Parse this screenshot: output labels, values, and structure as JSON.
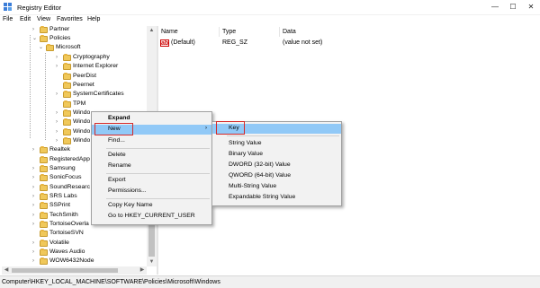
{
  "window": {
    "title": "Registry Editor",
    "minimize_icon": "—",
    "maximize_icon": "☐",
    "close_icon": "✕"
  },
  "menu": [
    "File",
    "Edit",
    "View",
    "Favorites",
    "Help"
  ],
  "tree": [
    {
      "label": "Partner",
      "expander": "›"
    },
    {
      "label": "Policies",
      "expander": "⌄"
    },
    {
      "label": "Microsoft",
      "expander": "⌄"
    },
    {
      "label": "Cryptography",
      "expander": "›"
    },
    {
      "label": "Internet Explorer",
      "expander": "›"
    },
    {
      "label": "PeerDist",
      "expander": ""
    },
    {
      "label": "Peernet",
      "expander": ""
    },
    {
      "label": "SystemCertificates",
      "expander": "›"
    },
    {
      "label": "TPM",
      "expander": ""
    },
    {
      "label": "Windo",
      "expander": "›"
    },
    {
      "label": "Windo",
      "expander": "›"
    },
    {
      "label": "Windo",
      "expander": "›"
    },
    {
      "label": "Windo",
      "expander": "›"
    },
    {
      "label": "Realtek",
      "expander": "›"
    },
    {
      "label": "RegisteredApp",
      "expander": ""
    },
    {
      "label": "Samsung",
      "expander": "›"
    },
    {
      "label": "SonicFocus",
      "expander": "›"
    },
    {
      "label": "SoundResearc",
      "expander": "›"
    },
    {
      "label": "SRS Labs",
      "expander": "›"
    },
    {
      "label": "SSPrint",
      "expander": "›"
    },
    {
      "label": "TechSmith",
      "expander": "›"
    },
    {
      "label": "TortoiseOverla",
      "expander": "›"
    },
    {
      "label": "TortoiseSVN",
      "expander": ""
    },
    {
      "label": "Volatile",
      "expander": "›"
    },
    {
      "label": "Waves Audio",
      "expander": "›"
    },
    {
      "label": "WOW6432Node",
      "expander": "›"
    }
  ],
  "list": {
    "columns": [
      "Name",
      "Type",
      "Data"
    ],
    "rows": [
      {
        "name": "(Default)",
        "type": "REG_SZ",
        "data": "(value not set)"
      }
    ]
  },
  "context_menu": {
    "items": [
      "Expand",
      "New",
      "Find...",
      "Delete",
      "Rename",
      "Export",
      "Permissions...",
      "Copy Key Name",
      "Go to HKEY_CURRENT_USER"
    ],
    "submenu_arrow": "›"
  },
  "submenu": {
    "items": [
      "Key",
      "String Value",
      "Binary Value",
      "DWORD (32-bit) Value",
      "QWORD (64-bit) Value",
      "Multi-String Value",
      "Expandable String Value"
    ]
  },
  "status": {
    "path": "Computer\\HKEY_LOCAL_MACHINE\\SOFTWARE\\Policies\\Microsoft\\Windows"
  },
  "colors": {
    "highlight": "#91c9f7",
    "callout_border": "#d42a2a",
    "folder": "#f0c85a"
  }
}
